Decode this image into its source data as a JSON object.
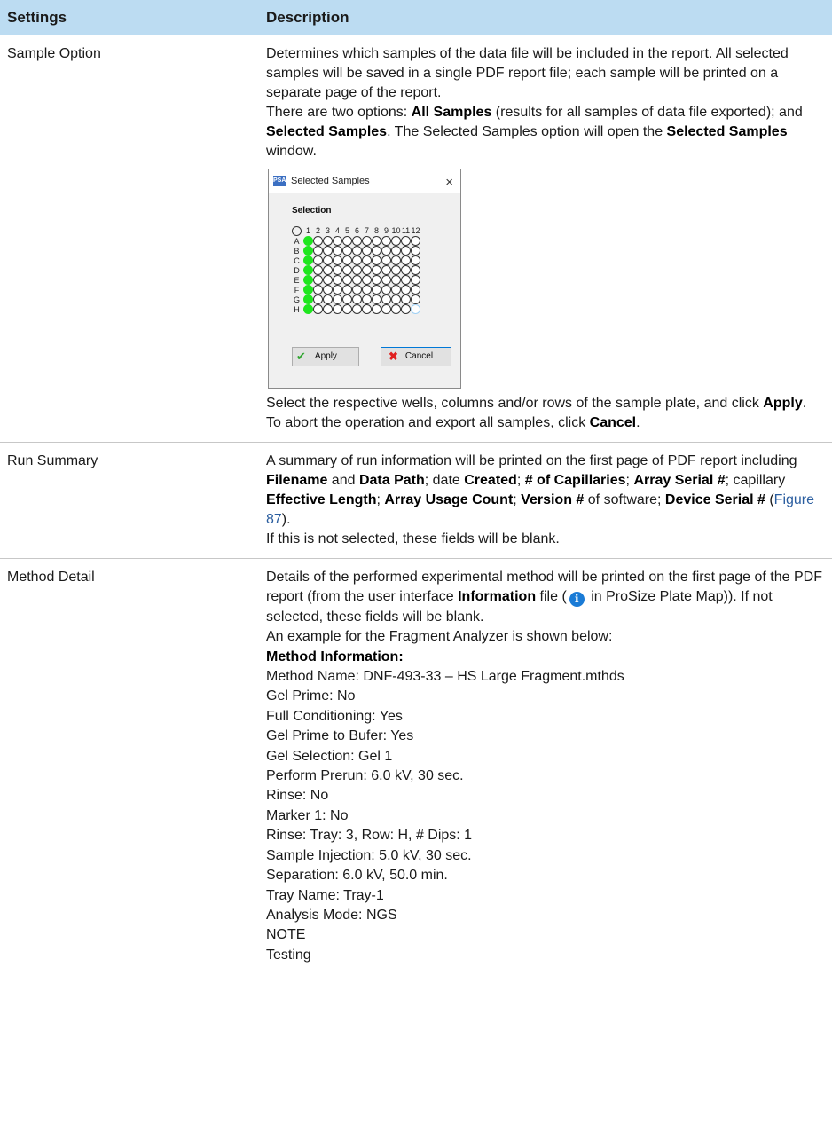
{
  "header": {
    "col_settings": "Settings",
    "col_description": "Description"
  },
  "sample_option": {
    "setting": "Sample Option",
    "p1": "Determines which samples of the data file will be included in the report. All selected samples will be saved in a single PDF report file; each sample will be printed on a separate page of the report.",
    "p2_a": "There are two options: ",
    "p2_all": "All Samples",
    "p2_b": " (results for all samples of data file exported); and ",
    "p2_sel": "Selected Samples",
    "p2_c": ". The Selected Samples option will open the ",
    "p2_win": "Selected Samples",
    "p2_d": " window.",
    "p3_a": "Select the respective wells, columns and/or rows of the sample plate, and click ",
    "p3_apply": "Apply",
    "p3_b": ". To abort the operation and export all samples, click ",
    "p3_cancel": "Cancel",
    "p3_c": ".",
    "dialog": {
      "app_icon": "PSA",
      "title": "Selected Samples",
      "close": "×",
      "selection_label": "Selection",
      "columns": [
        "1",
        "2",
        "3",
        "4",
        "5",
        "6",
        "7",
        "8",
        "9",
        "10",
        "11",
        "12"
      ],
      "rows": [
        "A",
        "B",
        "C",
        "D",
        "E",
        "F",
        "G",
        "H"
      ],
      "selected_column": "1",
      "apply_label": "Apply",
      "cancel_label": "Cancel",
      "accent_green": "#1ee61e"
    }
  },
  "run_summary": {
    "setting": "Run Summary",
    "t1": "A summary of run information will be printed on the first page of PDF report including ",
    "b1": "Filename",
    "t2": " and ",
    "b2": "Data Path",
    "t3": "; date ",
    "b3": "Created",
    "t4": "; ",
    "b4": "# of Capillaries",
    "t5": ";",
    "b5": "Array Serial #",
    "t6": "; capillary ",
    "b6": "Effective Length",
    "t7": "; ",
    "b7": "Array Usage Count",
    "t8": "; ",
    "b8": "Version #",
    "t9": " of software; ",
    "b9": "Device Serial #",
    "t10": " (",
    "fig": "Figure 87",
    "t11": ").",
    "p2": "If this is not selected, these fields will be blank."
  },
  "method_detail": {
    "setting": "Method Detail",
    "t1": "Details of the performed experimental method will be printed on the first page of the PDF report (from the user interface ",
    "b1": "Information",
    "t2": " file (",
    "icon": "i",
    "t3": " in ProSize Plate Map)). If not selected, these fields will be blank.",
    "p2": "An example for the Fragment Analyzer is shown below:",
    "heading": "Method Information:",
    "lines": [
      "Method Name: DNF-493-33 – HS Large Fragment.mthds",
      "Gel Prime: No",
      "Full Conditioning: Yes",
      "Gel Prime to Bufer: Yes",
      "Gel Selection: Gel 1",
      "Perform Prerun: 6.0 kV, 30 sec.",
      "Rinse: No",
      "Marker 1: No",
      "Rinse: Tray: 3, Row: H, # Dips: 1",
      "Sample Injection: 5.0 kV, 30 sec.",
      "Separation: 6.0 kV, 50.0 min.",
      "Tray Name: Tray-1",
      "Analysis Mode: NGS",
      "NOTE",
      "Testing"
    ]
  }
}
